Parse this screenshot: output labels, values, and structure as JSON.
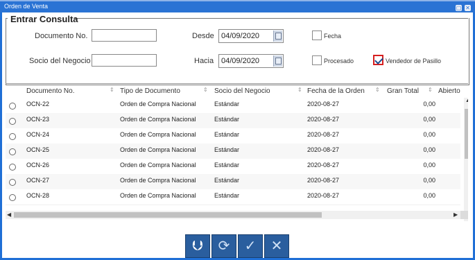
{
  "window": {
    "title": "Orden de Venta"
  },
  "form": {
    "legend": "Entrar Consulta",
    "documento_label": "Documento No.",
    "documento_value": "",
    "socio_label": "Socio del Negocio",
    "socio_value": "",
    "desde_label": "Desde",
    "desde_value": "04/09/2020",
    "hacia_label": "Hacia",
    "hacia_value": "04/09/2020",
    "fecha_label": "Fecha",
    "procesado_label": "Procesado",
    "vendedor_label": "Vendedor de Pasillo"
  },
  "grid": {
    "columns": [
      "Documento No.",
      "Tipo de Documento",
      "Socio del Negocio",
      "Fecha de la Orden",
      "Gran Total",
      "Abierto"
    ],
    "rows": [
      [
        "OCN-22",
        "Orden de Compra Nacional",
        "Estándar",
        "2020-08-27",
        "0,00"
      ],
      [
        "OCN-23",
        "Orden de Compra Nacional",
        "Estándar",
        "2020-08-27",
        "0,00"
      ],
      [
        "OCN-24",
        "Orden de Compra Nacional",
        "Estándar",
        "2020-08-27",
        "0,00"
      ],
      [
        "OCN-25",
        "Orden de Compra Nacional",
        "Estándar",
        "2020-08-27",
        "0,00"
      ],
      [
        "OCN-26",
        "Orden de Compra Nacional",
        "Estándar",
        "2020-08-27",
        "0,00"
      ],
      [
        "OCN-27",
        "Orden de Compra Nacional",
        "Estándar",
        "2020-08-27",
        "0,00"
      ],
      [
        "OCN-28",
        "Orden de Compra Nacional",
        "Estándar",
        "2020-08-27",
        "0,00"
      ]
    ]
  },
  "icons": {
    "back": "undo-arrow-icon",
    "refresh": "refresh-icon",
    "ok": "checkmark-icon",
    "cancel": "close-x-icon"
  },
  "colors": {
    "accent": "#2a73d4",
    "button": "#2a5e9e",
    "highlight": "#d61f1f"
  }
}
